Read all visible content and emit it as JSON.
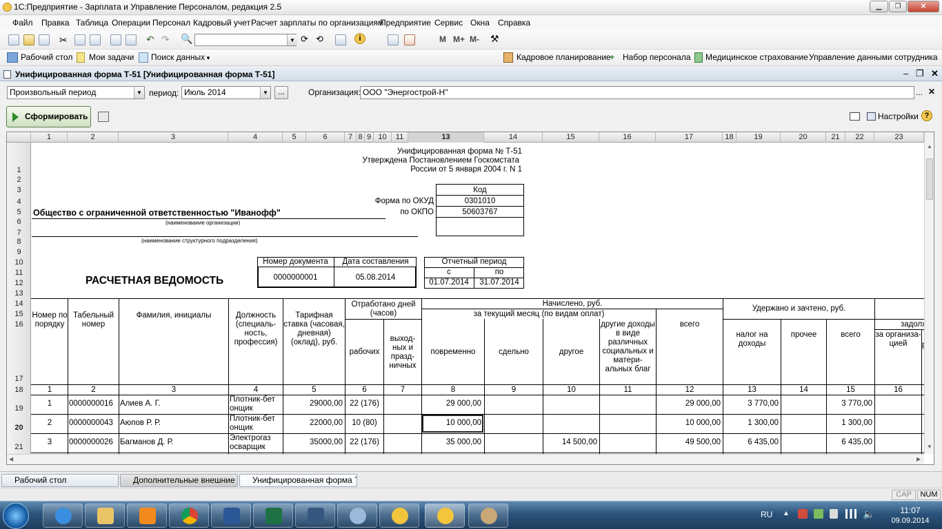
{
  "window": {
    "title": "1С:Предприятие - Зарплата и Управление Персоналом, редакция 2.5"
  },
  "menu": [
    "Файл",
    "Правка",
    "Таблица",
    "Операции",
    "Персонал",
    "Кадровый учет",
    "Расчет зарплаты по организациям",
    "Предприятие",
    "Сервис",
    "Окна",
    "Справка"
  ],
  "toolbar2": {
    "desktop": "Рабочий стол",
    "tasks": "Мои задачи",
    "search": "Поиск данных",
    "panels": [
      "Кадровое планирование",
      "Набор персонала",
      "Медицинское страхование",
      "Управление данными сотрудника"
    ]
  },
  "toolbar1": {
    "mplus": "M+",
    "mminus": "M-",
    "m": "M"
  },
  "document": {
    "title": "Унифицированная форма Т-51 [Унифицированная форма Т-51]"
  },
  "form": {
    "period_type": "Произвольный период",
    "period_label": "период:",
    "period_value": "Июль 2014",
    "ellipsis": "...",
    "org_label": "Организация:",
    "org_value": "ООО \"Энергострой-Н\"",
    "generate": "Сформировать",
    "settings": "Настройки"
  },
  "sheet": {
    "col_headers": [
      "1",
      "2",
      "3",
      "4",
      "5",
      "6",
      "7",
      "8",
      "9",
      "10",
      "11",
      "13",
      "14",
      "15",
      "16",
      "17",
      "18",
      "19",
      "20",
      "21",
      "22",
      "23"
    ],
    "row_headers": [
      "1",
      "2",
      "3",
      "4",
      "5",
      "6",
      "7",
      "8",
      "9",
      "10",
      "11",
      "12",
      "13",
      "14",
      "15",
      "16",
      "17",
      "18",
      "19",
      "20",
      "21"
    ],
    "header_lines": [
      "Унифицированная форма № Т-51",
      "Утверждена Постановлением Госкомстата",
      "России от 5 января 2004 г. N 1"
    ],
    "code_label": "Код",
    "okud_label": "Форма по ОКУД",
    "okud": "0301010",
    "okpo_label": "по ОКПО",
    "okpo": "50603767",
    "org_name": "Общество с ограниченной ответственностью \"Иванофф\"",
    "org_caption": "(наименование организации)",
    "dept_caption": "(наименование структурного подразделения)",
    "doc_num_label": "Номер документа",
    "doc_date_label": "Дата составления",
    "doc_num": "0000000001",
    "doc_date": "05.08.2014",
    "report_period_label": "Отчетный период",
    "from_label": "с",
    "to_label": "по",
    "period_from": "01.07.2014",
    "period_to": "31.07.2014",
    "doc_title": "РАСЧЕТНАЯ ВЕДОМОСТЬ",
    "th": {
      "num": "Номер по порядку",
      "tab": "Табельный номер",
      "fio": "Фамилия, инициалы",
      "pos": "Должность (специаль-ность, профессия)",
      "rate": "Тарифная ставка (часовая, дневная) (оклад), руб.",
      "worked": "Отработано дней (часов)",
      "workdays": "рабочих",
      "holidays": "выход-ных и празд-ничных",
      "accrued": "Начислено, руб.",
      "current": "за текущий месяц (по видам оплат)",
      "time": "повременно",
      "piece": "сдельно",
      "other": "другое",
      "other_income": "другие доходы в виде различных социальных и матери-альных благ",
      "total": "всего",
      "withheld": "Удержано и зачтено, руб.",
      "tax": "налог на доходы",
      "misc": "прочее",
      "wtotal": "всего",
      "debt": "задолже",
      "debt_org": "за организа-цией",
      "debt_emp": "р"
    },
    "col_numbers": [
      "1",
      "2",
      "3",
      "4",
      "5",
      "6",
      "7",
      "8",
      "9",
      "10",
      "11",
      "12",
      "13",
      "14",
      "15",
      "16"
    ],
    "rows": [
      {
        "n": "1",
        "tab": "0000000016",
        "fio": "Алиев А. Г.",
        "pos": "Плотник-бет онщик",
        "rate": "29000,00",
        "days": "22 (176)",
        "time": "29 000,00",
        "other": "",
        "total": "29 000,00",
        "tax": "3 770,00",
        "wtotal": "3 770,00"
      },
      {
        "n": "2",
        "tab": "0000000043",
        "fio": "Аюпов Р. Р.",
        "pos": "Плотник-бет онщик",
        "rate": "22000,00",
        "days": "10 (80)",
        "time": "10 000,00",
        "other": "",
        "total": "10 000,00",
        "tax": "1 300,00",
        "wtotal": "1 300,00"
      },
      {
        "n": "3",
        "tab": "0000000026",
        "fio": "Багманов Д. Р.",
        "pos": "Электрогаз осварщик",
        "rate": "35000,00",
        "days": "22 (176)",
        "time": "35 000,00",
        "other": "14 500,00",
        "total": "49 500,00",
        "tax": "6 435,00",
        "wtotal": "6 435,00"
      }
    ]
  },
  "window_tabs": [
    "Рабочий стол",
    "Дополнительные внешние ...",
    "Унифицированная форма Т..."
  ],
  "status": {
    "cap": "CAP",
    "num": "NUM"
  },
  "tray": {
    "lang": "RU",
    "time": "11:07",
    "date": "09.09.2014"
  }
}
